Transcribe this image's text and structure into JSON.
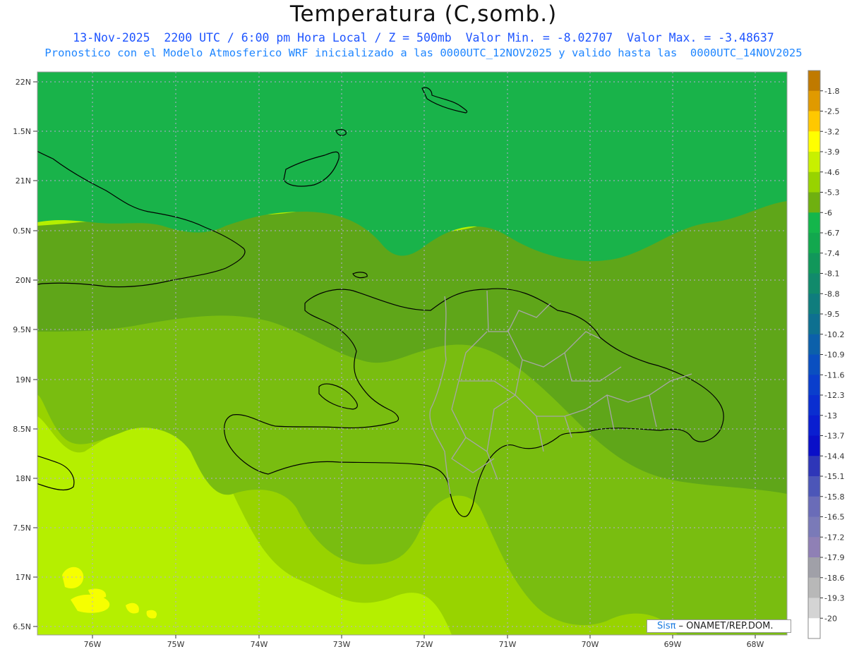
{
  "header": {
    "title": "Temperatura (C,somb.)",
    "line1": "13-Nov-2025  2200 UTC / 6:00 pm Hora Local / Z = 500mb  Valor Min. = -8.02707  Valor Max. = -3.48637",
    "line2": "Pronostico con el Modelo Atmosferico WRF inicializado a las 0000UTC_12NOV2025 y valido hasta las  0000UTC_14NOV2025"
  },
  "map": {
    "lat_labels": [
      "22N",
      "1.5N",
      "21N",
      "0.5N",
      "20N",
      "9.5N",
      "19N",
      "8.5N",
      "18N",
      "7.5N",
      "17N",
      "6.5N"
    ],
    "lon_labels": [
      "76W",
      "75W",
      "74W",
      "73W",
      "72W",
      "71W",
      "70W",
      "69W",
      "68W"
    ],
    "gridlines": true,
    "colors": {
      "ocean_north": "#19b34a",
      "band_dark": "#5fa619",
      "band_mid": "#79bd10",
      "band_light": "#98d300",
      "band_lime": "#b5ef00",
      "yellow": "#f6ff00"
    }
  },
  "colorbar": {
    "labels": [
      "-1.8",
      "-2.5",
      "-3.2",
      "-3.9",
      "-4.6",
      "-5.3",
      "-6",
      "-6.7",
      "-7.4",
      "-8.1",
      "-8.8",
      "-9.5",
      "-10.2",
      "-10.9",
      "-11.6",
      "-12.3",
      "-13",
      "-13.7",
      "-14.4",
      "-15.1",
      "-15.8",
      "-16.5",
      "-17.2",
      "-17.9",
      "-18.6",
      "-19.3",
      "-20"
    ],
    "colors": [
      "#c07a00",
      "#e09a00",
      "#ffc800",
      "#ffff00",
      "#c8f000",
      "#98d300",
      "#6fb010",
      "#14b64b",
      "#12a84e",
      "#11975a",
      "#118a6b",
      "#0f7d7d",
      "#0e7090",
      "#0c60aa",
      "#0a4fc0",
      "#0a3ecc",
      "#0a2ed0",
      "#0a1ed0",
      "#0a0fc8",
      "#2e36b8",
      "#4c56b8",
      "#6a6cb8",
      "#7a7ab8",
      "#8f80b5",
      "#a0a0a8",
      "#b8b8b8",
      "#d4d4d4",
      "#ffffff"
    ]
  },
  "footer": {
    "brand": "Sisπ",
    "org": "– ONAMET/REP.DOM."
  }
}
